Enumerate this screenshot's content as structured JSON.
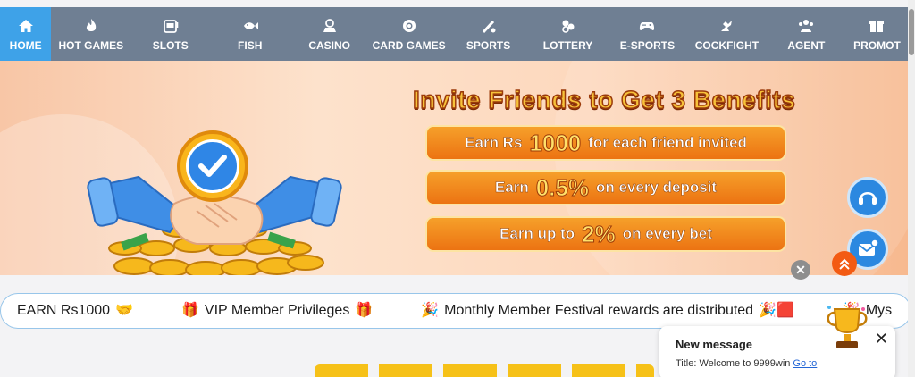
{
  "nav": {
    "items": [
      {
        "label": "HOME",
        "icon": "home-icon"
      },
      {
        "label": "HOT GAMES",
        "icon": "flame-icon"
      },
      {
        "label": "SLOTS",
        "icon": "slot-machine-icon"
      },
      {
        "label": "FISH",
        "icon": "fish-icon"
      },
      {
        "label": "CASINO",
        "icon": "casino-icon"
      },
      {
        "label": "CARD GAMES",
        "icon": "poker-chip-icon"
      },
      {
        "label": "SPORTS",
        "icon": "sports-icon"
      },
      {
        "label": "LOTTERY",
        "icon": "lottery-balls-icon"
      },
      {
        "label": "E-SPORTS",
        "icon": "gamepad-icon"
      },
      {
        "label": "COCKFIGHT",
        "icon": "cockfight-icon"
      },
      {
        "label": "AGENT",
        "icon": "agent-icon"
      },
      {
        "label": "PROMOT",
        "icon": "gift-icon"
      }
    ]
  },
  "banner": {
    "title": "Invite Friends to Get 3 Benefits",
    "rows": [
      {
        "pre": "Earn Rs",
        "big": "1000",
        "post": "for each friend invited"
      },
      {
        "pre": "Earn",
        "big": "0.5%",
        "post": "on every deposit"
      },
      {
        "pre": "Earn up to",
        "big": "2%",
        "post": "on every bet"
      }
    ]
  },
  "float": {
    "close_label": "✕"
  },
  "marquee": {
    "items": [
      {
        "text": "EARN Rs1000",
        "pre": "",
        "post": "🤝"
      },
      {
        "text": "VIP Member Privileges",
        "pre": "🎁",
        "post": "🎁"
      },
      {
        "text": "Monthly Member Festival rewards are distributed",
        "pre": "🎉",
        "post": "🎉🟥"
      },
      {
        "text": "Mys",
        "pre": "🎉",
        "post": ""
      }
    ]
  },
  "notification": {
    "title": "New message",
    "body": "Title: Welcome to 9999win",
    "link": "Go to",
    "close": "✕"
  },
  "colors": {
    "nav_bg": "#6f7f93",
    "nav_active": "#3ea2e8",
    "accent_orange": "#ec7312",
    "accent_blue": "#2b88e0"
  }
}
